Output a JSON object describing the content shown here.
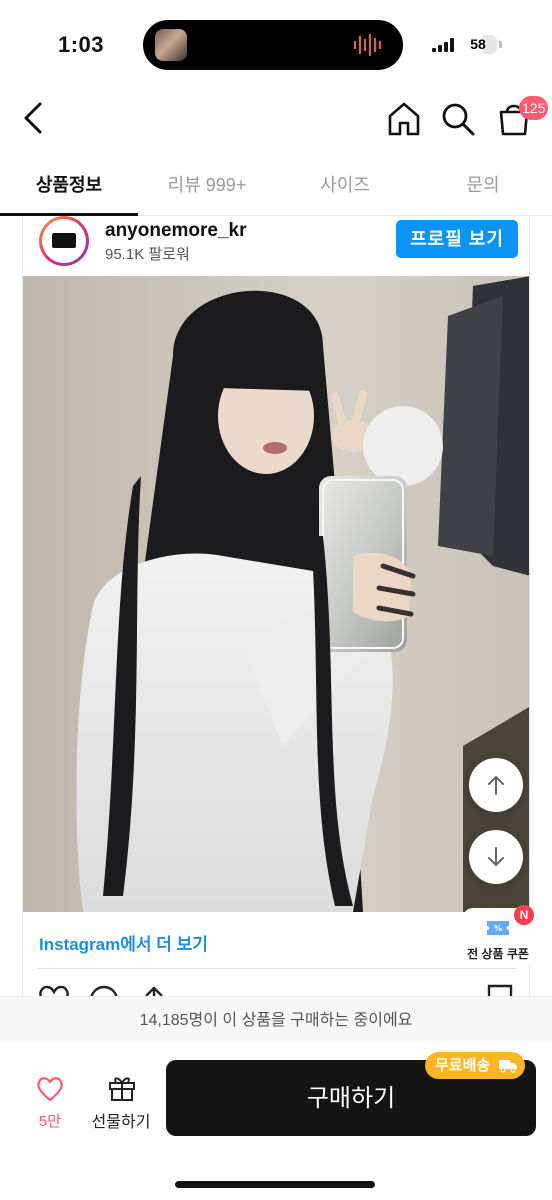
{
  "status_bar": {
    "time": "1:03",
    "battery_level": "58",
    "battery_fraction": 0.58
  },
  "nav": {
    "cart_badge": "125"
  },
  "tabs": [
    {
      "label": "상품정보",
      "active": true
    },
    {
      "label": "리뷰 999+",
      "active": false
    },
    {
      "label": "사이즈",
      "active": false
    },
    {
      "label": "문의",
      "active": false
    }
  ],
  "instagram": {
    "username": "anyonemore_kr",
    "followers": "95.1K 팔로워",
    "profile_button": "프로필 보기",
    "more_link": "Instagram에서 더 보기",
    "button_color": "#0a95f6"
  },
  "floating": {
    "coupon_label": "전 상품 쿠폰",
    "coupon_badge": "N"
  },
  "purchase": {
    "info": "14,185명이 이 상품을 구매하는 중이에요",
    "like_count": "5만",
    "gift_label": "선물하기",
    "buy_label": "구매하기",
    "shipping_badge": "무료배송",
    "accent_color": "#ff5a6e",
    "shipping_color": "#ffb524"
  },
  "icons": [
    "chevron-left",
    "home",
    "search",
    "shopping-bag",
    "arrow-up",
    "arrow-down",
    "ticket",
    "heart",
    "gift",
    "truck"
  ]
}
